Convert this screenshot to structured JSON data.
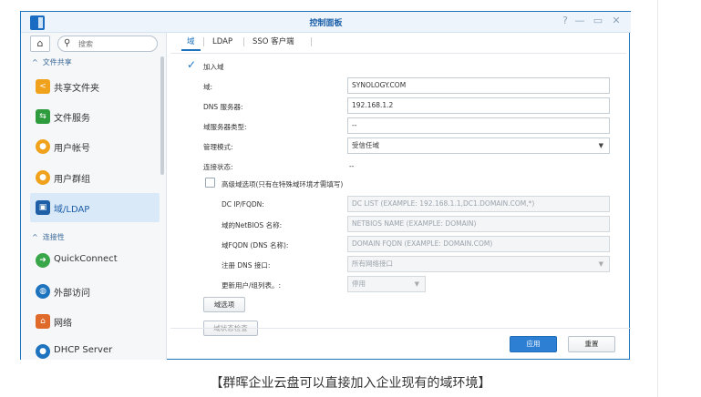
{
  "window": {
    "title": "控制面板",
    "help_glyph": "?",
    "minimize_glyph": "—",
    "maximize_glyph": "▭",
    "close_glyph": "✕"
  },
  "sidebar": {
    "search_placeholder": "搜索",
    "home_glyph": "⌂",
    "section_file_sharing": "文件共享",
    "section_connectivity": "连接性",
    "items": [
      {
        "label": "共享文件夹",
        "icon": "shared-folder-icon",
        "color": "#f0a21c"
      },
      {
        "label": "文件服务",
        "icon": "file-services-icon",
        "color": "#2e9b3d"
      },
      {
        "label": "用户帐号",
        "icon": "user-icon",
        "color": "#f0a21c"
      },
      {
        "label": "用户群组",
        "icon": "group-icon",
        "color": "#f0a21c"
      },
      {
        "label": "域/LDAP",
        "icon": "domain-ldap-icon",
        "color": "#1e5fa8"
      },
      {
        "label": "QuickConnect",
        "icon": "quickconnect-icon",
        "color": "#3aa64a"
      },
      {
        "label": "外部访问",
        "icon": "globe-icon",
        "color": "#1e73be"
      },
      {
        "label": "网络",
        "icon": "network-icon",
        "color": "#e06a2a"
      },
      {
        "label": "DHCP Server",
        "icon": "dhcp-icon",
        "color": "#1e73be"
      }
    ]
  },
  "tabs": [
    "域",
    "LDAP",
    "SSO 客户端"
  ],
  "form": {
    "join_domain_label": "加入域",
    "domain_label": "域:",
    "domain_value": "SYNOLOGY.COM",
    "dns_label": "DNS 服务器:",
    "dns_value": "192.168.1.2",
    "server_type_label": "域服务器类型:",
    "server_type_value": "--",
    "mgmt_mode_label": "管理模式:",
    "mgmt_mode_value": "受信任域",
    "conn_status_label": "连接状态:",
    "conn_status_value": "--",
    "advanced_label": "高级域选项(只有在特殊域环境才需填写)",
    "dc_label": "DC IP/FQDN:",
    "dc_placeholder": "DC LIST (EXAMPLE: 192.168.1.1,DC1.DOMAIN.COM,*)",
    "netbios_label": "域的NetBIOS 名称:",
    "netbios_placeholder": "NETBIOS NAME (EXAMPLE: DOMAIN)",
    "fqdn_label": "域FQDN (DNS 名称):",
    "fqdn_placeholder": "DOMAIN FQDN (EXAMPLE: DOMAIN.COM)",
    "register_dns_label": "注册 DNS 接口:",
    "register_dns_value": "所有网络接口",
    "update_users_label": "更新用户/组列表。:",
    "update_users_value": "停用",
    "domain_options_btn": "域选项",
    "domain_status_btn": "域状态检查"
  },
  "footer": {
    "apply": "应用",
    "reset": "重置"
  },
  "caption": "【群晖企业云盘可以直接加入企业现有的域环境】"
}
